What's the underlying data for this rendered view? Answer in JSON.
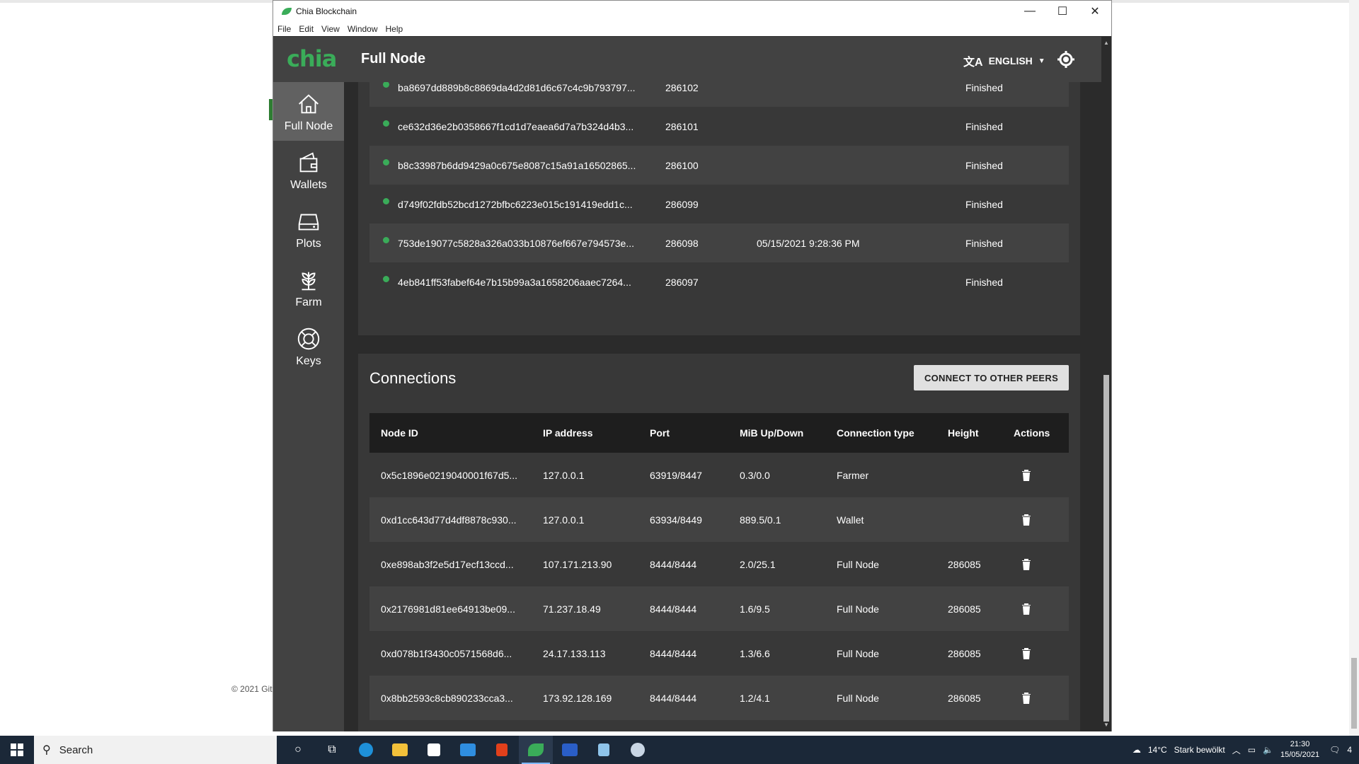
{
  "window": {
    "title": "Chia Blockchain",
    "controls": [
      "—",
      "☐",
      "✕"
    ]
  },
  "menu": [
    "File",
    "Edit",
    "View",
    "Window",
    "Help"
  ],
  "header": {
    "logo": "chia",
    "title": "Full Node",
    "language": "ENGLISH"
  },
  "sidebar": [
    {
      "label": "Full Node",
      "icon": "home-icon",
      "active": true
    },
    {
      "label": "Wallets",
      "icon": "wallet-icon",
      "active": false
    },
    {
      "label": "Plots",
      "icon": "storage-icon",
      "active": false
    },
    {
      "label": "Farm",
      "icon": "plant-icon",
      "active": false
    },
    {
      "label": "Keys",
      "icon": "lifebuoy-icon",
      "active": false
    }
  ],
  "blocks": [
    {
      "hash": "ba8697dd889b8c8869da4d2d81d6c67c4c9b793797...",
      "height": "286102",
      "time": "",
      "state": "Finished"
    },
    {
      "hash": "ce632d36e2b0358667f1cd1d7eaea6d7a7b324d4b3...",
      "height": "286101",
      "time": "",
      "state": "Finished"
    },
    {
      "hash": "b8c33987b6dd9429a0c675e8087c15a91a16502865...",
      "height": "286100",
      "time": "",
      "state": "Finished"
    },
    {
      "hash": "d749f02fdb52bcd1272bfbc6223e015c191419edd1c...",
      "height": "286099",
      "time": "",
      "state": "Finished"
    },
    {
      "hash": "753de19077c5828a326a033b10876ef667e794573e...",
      "height": "286098",
      "time": "05/15/2021 9:28:36 PM",
      "state": "Finished"
    },
    {
      "hash": "4eb841ff53fabef64e7b15b99a3a1658206aaec7264...",
      "height": "286097",
      "time": "",
      "state": "Finished"
    }
  ],
  "connections": {
    "title": "Connections",
    "connect_button": "CONNECT TO OTHER PEERS",
    "headers": [
      "Node ID",
      "IP address",
      "Port",
      "MiB Up/Down",
      "Connection type",
      "Height",
      "Actions"
    ],
    "rows": [
      {
        "node_id": "0x5c1896e0219040001f67d5...",
        "ip": "127.0.0.1",
        "port": "63919/8447",
        "updown": "0.3/0.0",
        "type": "Farmer",
        "height": ""
      },
      {
        "node_id": "0xd1cc643d77d4df8878c930...",
        "ip": "127.0.0.1",
        "port": "63934/8449",
        "updown": "889.5/0.1",
        "type": "Wallet",
        "height": ""
      },
      {
        "node_id": "0xe898ab3f2e5d17ecf13ccd...",
        "ip": "107.171.213.90",
        "port": "8444/8444",
        "updown": "2.0/25.1",
        "type": "Full Node",
        "height": "286085"
      },
      {
        "node_id": "0x2176981d81ee64913be09...",
        "ip": "71.237.18.49",
        "port": "8444/8444",
        "updown": "1.6/9.5",
        "type": "Full Node",
        "height": "286085"
      },
      {
        "node_id": "0xd078b1f3430c0571568d6...",
        "ip": "24.17.133.113",
        "port": "8444/8444",
        "updown": "1.3/6.6",
        "type": "Full Node",
        "height": "286085"
      },
      {
        "node_id": "0x8bb2593c8cb890233cca3...",
        "ip": "173.92.128.169",
        "port": "8444/8444",
        "updown": "1.2/4.1",
        "type": "Full Node",
        "height": "286085"
      }
    ]
  },
  "background_page": {
    "footer": "© 2021 Git"
  },
  "taskbar": {
    "search": "Search",
    "weather_temp": "14°C",
    "weather_text": "Stark bewölkt",
    "time": "21:30",
    "date": "15/05/2021",
    "notifications": "4"
  },
  "colors": {
    "accent": "#3aac59",
    "header": "#424242",
    "background": "#2b2b2b"
  }
}
